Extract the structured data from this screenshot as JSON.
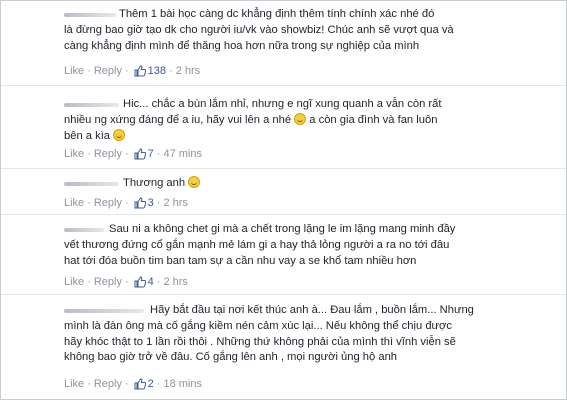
{
  "comments": [
    {
      "lines": [
        "Thêm 1 bài học càng dc khẳng định thêm tính chính xác nhé đó",
        "là đừng bao giờ tạo dk cho người iu/vk vào showbiz! Chúc anh sẽ vượt qua và",
        "càng khẳng định mình để thăng hoa hơn nữa trong sự nghiệp của mình"
      ],
      "like": "Like",
      "reply": "Reply",
      "likes": "138",
      "time": "2 hrs"
    },
    {
      "lines": [
        "Hic... chắc a bùn lắm nhỉ, nhưng e ngĩ xung quanh a vẫn còn rất",
        "nhiều ng xứng đáng để a iu, hãy vui lên a nhé",
        "bên a kìa"
      ],
      "line2_tail": "a còn gia đình và fan luôn",
      "like": "Like",
      "reply": "Reply",
      "likes": "7",
      "time": "47 mins"
    },
    {
      "lines": [
        "Thương anh"
      ],
      "like": "Like",
      "reply": "Reply",
      "likes": "3",
      "time": "2 hrs"
    },
    {
      "lines": [
        "Sau ni a không chet gi mà a chết trong lặng le im lặng mang minh đầy",
        "vết thương đứng cổ gắn mạnh mẻ lám gi a hay thả lỏng người a ra no tới đâu",
        "hat tới đóa buồn tim ban tam sự a cần nhu vay a se khổ tam nhiều hơn"
      ],
      "like": "Like",
      "reply": "Reply",
      "likes": "4",
      "time": "2 hrs"
    },
    {
      "lines": [
        "Hãy bắt đầu tại nơi kết thúc anh à... Đau lắm , buồn lắm... Nhưng",
        "mình là đàn ông mà cố gắng kiềm nén cảm xúc lại... Nếu không thể chịu được",
        "hãy khóc thật to 1 lần rồi thôi . Những thứ không phải của mình thì vĩnh viễn sẽ",
        "không bao giờ trở về đâu. Cố gắng lên anh , mọi người ủng hộ anh"
      ],
      "like": "Like",
      "reply": "Reply",
      "likes": "2",
      "time": "18 mins"
    }
  ]
}
